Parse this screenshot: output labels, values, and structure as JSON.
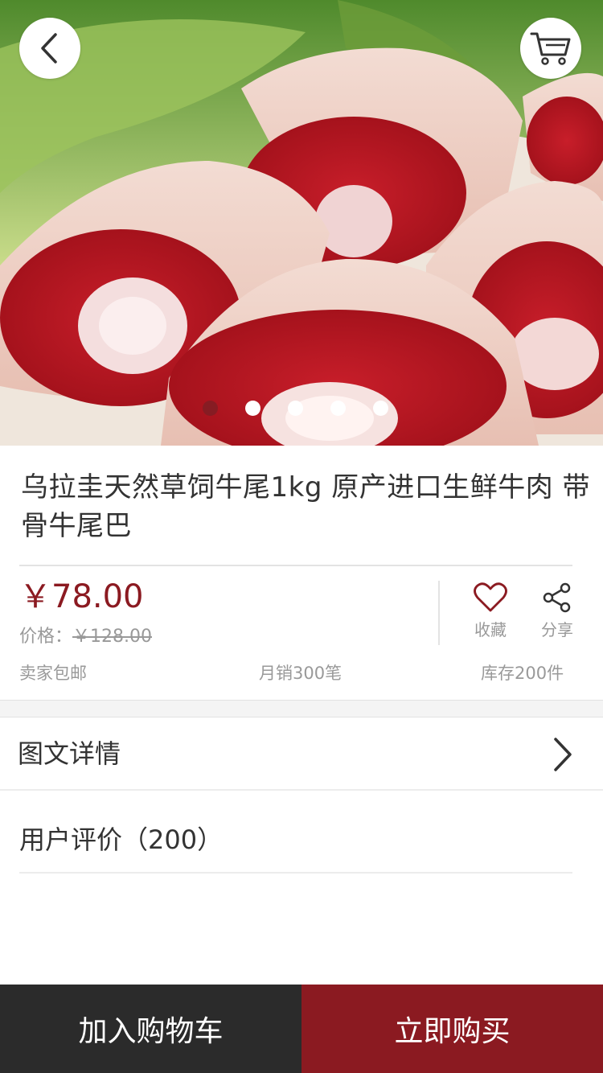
{
  "nav": {
    "back_icon": "chevron-left-icon",
    "cart_icon": "cart-icon"
  },
  "gallery": {
    "image": "oxtail-product-photo",
    "slide_count": 5,
    "active_slide": 1
  },
  "product": {
    "title": "乌拉圭天然草饲牛尾1kg 原产进口生鲜牛肉 带骨牛尾巴",
    "price": "￥78.00",
    "original_price_label": "价格：",
    "original_price": "￥128.00",
    "shipping": "卖家包邮",
    "monthly_sales": "月销300笔",
    "stock": "库存200件"
  },
  "actions": {
    "favorite_label": "收藏",
    "favorite_icon": "heart-icon",
    "share_label": "分享",
    "share_icon": "share-icon"
  },
  "sections": {
    "detail_label": "图文详情",
    "reviews_label": "用户评价（200）"
  },
  "bottom_bar": {
    "add_to_cart": "加入购物车",
    "buy_now": "立即购买"
  },
  "colors": {
    "accent": "#8b1a21",
    "dark_button": "#2b2b2b",
    "muted_text": "#999999"
  }
}
